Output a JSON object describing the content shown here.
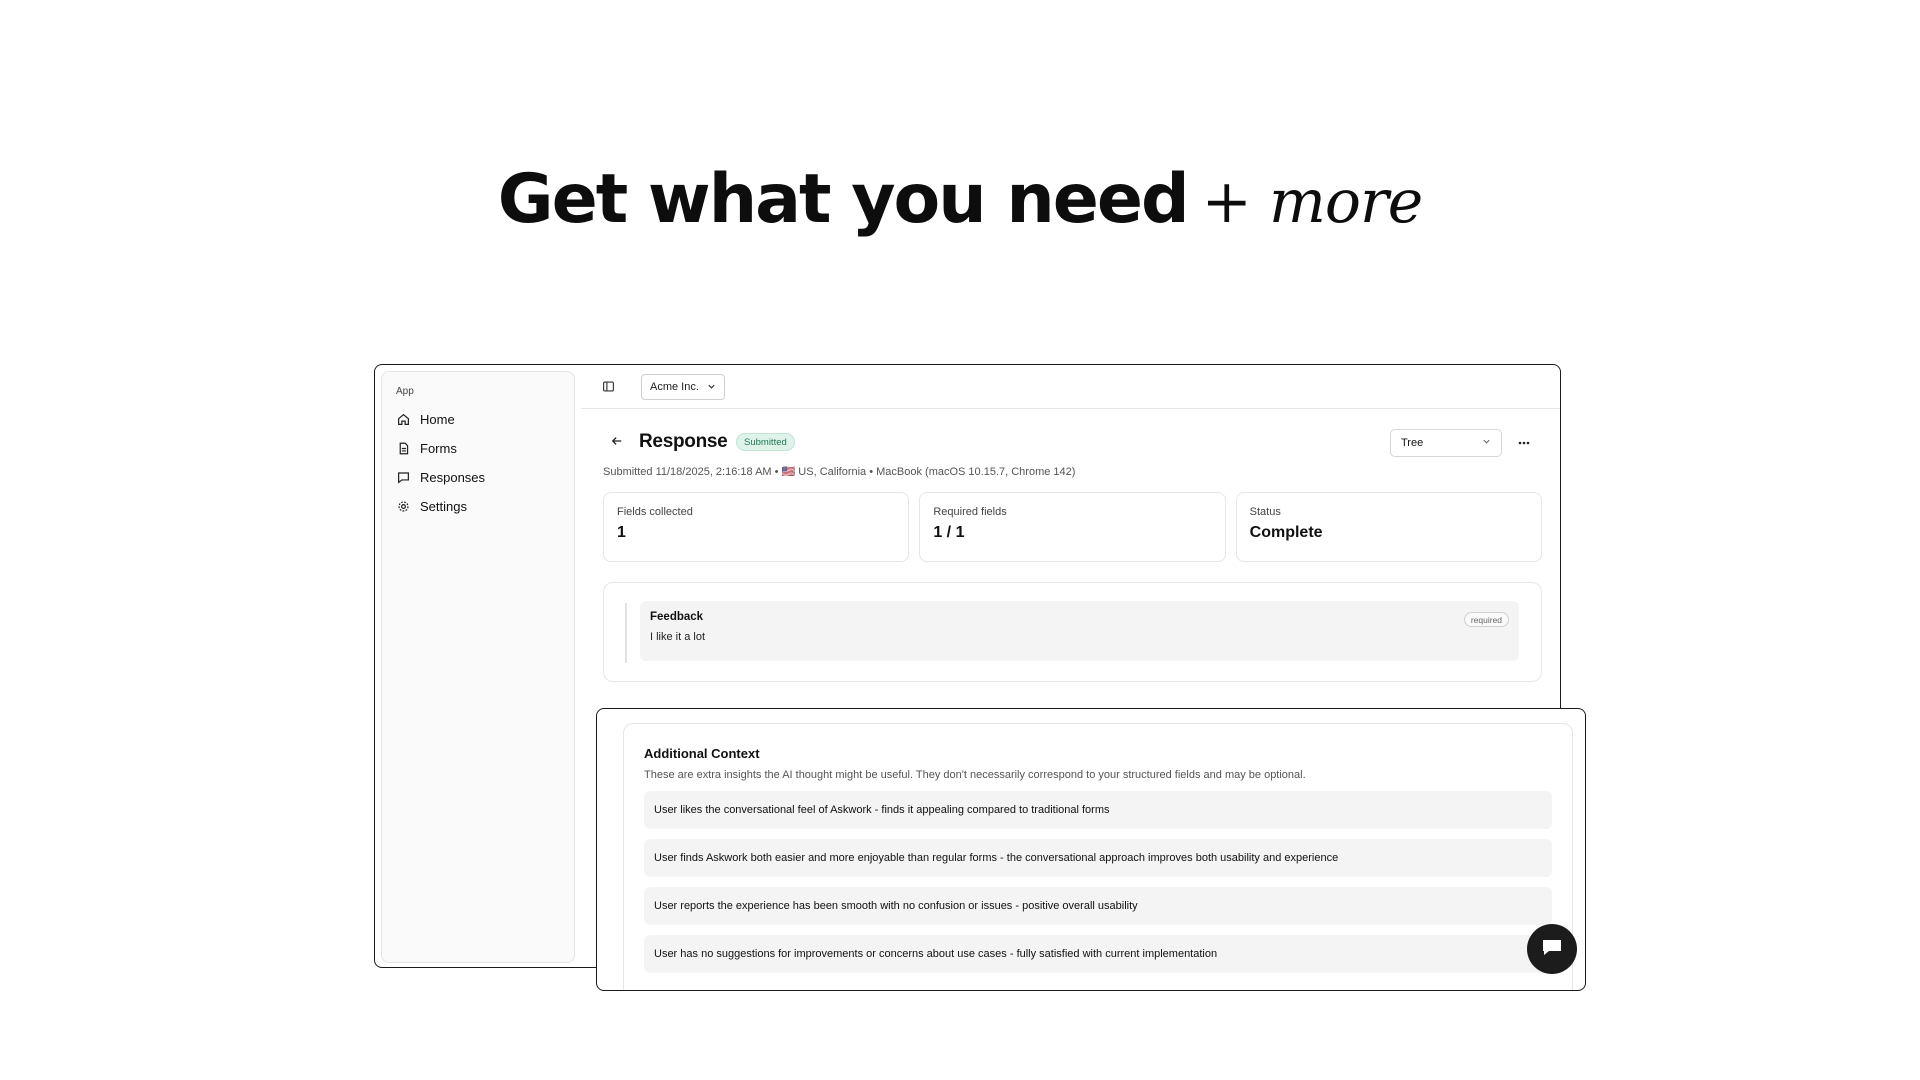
{
  "headline": {
    "main": "Get what you need",
    "accent": "+ more"
  },
  "sidebar": {
    "group_label": "App",
    "items": [
      {
        "label": "Home",
        "icon": "home-icon"
      },
      {
        "label": "Forms",
        "icon": "document-icon"
      },
      {
        "label": "Responses",
        "icon": "chat-icon"
      },
      {
        "label": "Settings",
        "icon": "gear-icon"
      }
    ]
  },
  "topbar": {
    "org": "Acme Inc."
  },
  "response": {
    "title": "Response",
    "status": "Submitted",
    "view": "Tree",
    "meta": "Submitted 11/18/2025, 2:16:18 AM • 🇺🇸 US, California • MacBook (macOS 10.15.7, Chrome 142)"
  },
  "stats": [
    {
      "label": "Fields collected",
      "value": "1"
    },
    {
      "label": "Required fields",
      "value": "1 / 1"
    },
    {
      "label": "Status",
      "value": "Complete"
    }
  ],
  "field": {
    "name": "Feedback",
    "value": "I like it a lot",
    "badge": "required"
  },
  "context": {
    "title": "Additional Context",
    "subtitle": "These are extra insights the AI thought might be useful. They don't necessarily correspond to your structured fields and may be optional.",
    "items": [
      "User likes the conversational feel of Askwork - finds it appealing compared to traditional forms",
      "User finds Askwork both easier and more enjoyable than regular forms - the conversational approach improves both usability and experience",
      "User reports the experience has been smooth with no confusion or issues - positive overall usability",
      "User has no suggestions for improvements or concerns about use cases - fully satisfied with current implementation"
    ]
  },
  "colors": {
    "status_bg": "#dff3ea",
    "status_text": "#1f7a55",
    "fab": "#1c1c1c"
  }
}
